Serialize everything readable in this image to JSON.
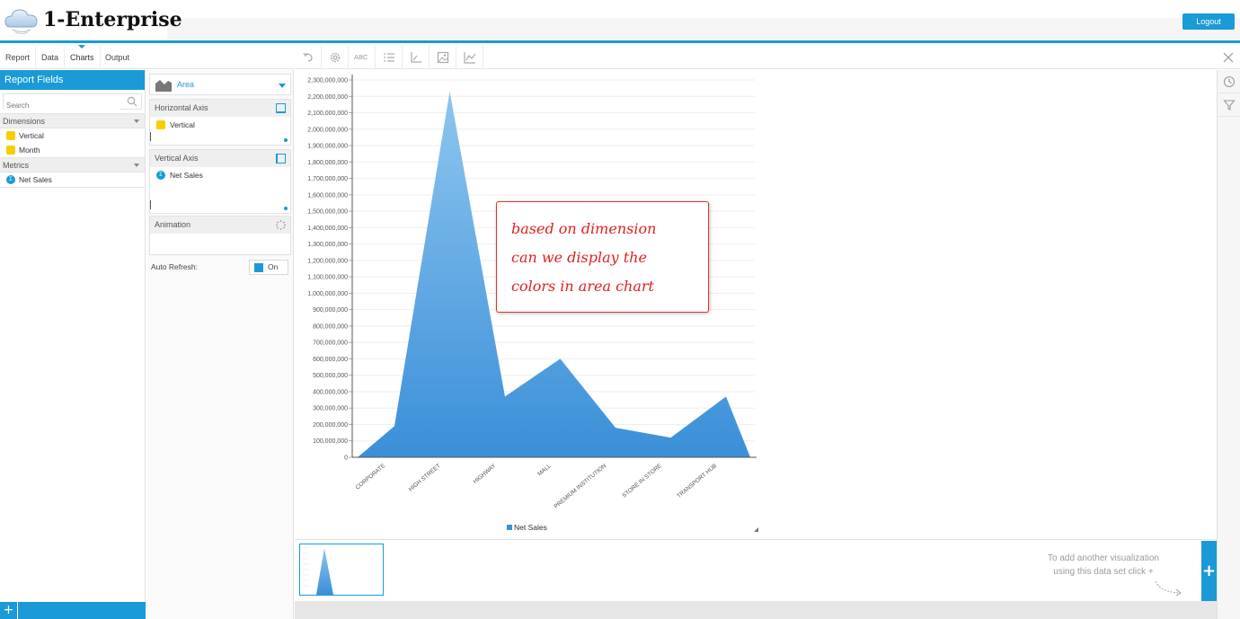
{
  "app": {
    "brand": "1-Enterprise",
    "logout_label": "Logout"
  },
  "nav": {
    "tabs": [
      {
        "label": "Report"
      },
      {
        "label": "Data"
      },
      {
        "label": "Charts",
        "active": true
      },
      {
        "label": "Output"
      }
    ]
  },
  "report_fields": {
    "title": "Report Fields",
    "search_placeholder": "Search",
    "dimensions_label": "Dimensions",
    "dimensions": [
      "Vertical",
      "Month"
    ],
    "metrics_label": "Metrics",
    "metrics": [
      "Net Sales"
    ]
  },
  "config": {
    "chart_type": "Area",
    "horizontal_axis_label": "Horizontal Axis",
    "horizontal_axis_field": "Vertical",
    "vertical_axis_label": "Vertical Axis",
    "vertical_axis_field": "Net Sales",
    "animation_label": "Animation",
    "auto_refresh_label": "Auto Refresh:",
    "auto_refresh_value": "On"
  },
  "toolbar": {
    "abc_label": "ABC"
  },
  "annotation": {
    "lines": [
      "based on dimension",
      "can we display the",
      "colors in area chart"
    ]
  },
  "hint": {
    "line1": "To add another visualization",
    "line2": "using this data set click +"
  },
  "colors": {
    "accent": "#1a9ad6",
    "area_top": "#8ec6ef",
    "area_bottom": "#3a8fd8",
    "note_red": "#e02020",
    "dimension": "#f6cf00"
  },
  "chart_data": {
    "type": "area",
    "categories": [
      "CORPORATE",
      "HIGH STREET",
      "HIGHWAY",
      "MALL",
      "PREMIUM INSTITUTION",
      "STORE IN STORE",
      "TRANSPORT HUB"
    ],
    "series": [
      {
        "name": "Net Sales",
        "values": [
          190000000,
          2230000000,
          370000000,
          600000000,
          180000000,
          120000000,
          370000000
        ]
      }
    ],
    "ylim": [
      0,
      2300000000
    ],
    "yticks": [
      "0",
      "100,000,000",
      "200,000,000",
      "300,000,000",
      "400,000,000",
      "500,000,000",
      "600,000,000",
      "700,000,000",
      "800,000,000",
      "900,000,000",
      "1,000,000,000",
      "1,100,000,000",
      "1,200,000,000",
      "1,300,000,000",
      "1,400,000,000",
      "1,500,000,000",
      "1,600,000,000",
      "1,700,000,000",
      "1,800,000,000",
      "1,900,000,000",
      "2,000,000,000",
      "2,100,000,000",
      "2,200,000,000",
      "2,300,000,000"
    ],
    "legend_position": "bottom",
    "grid": true
  }
}
